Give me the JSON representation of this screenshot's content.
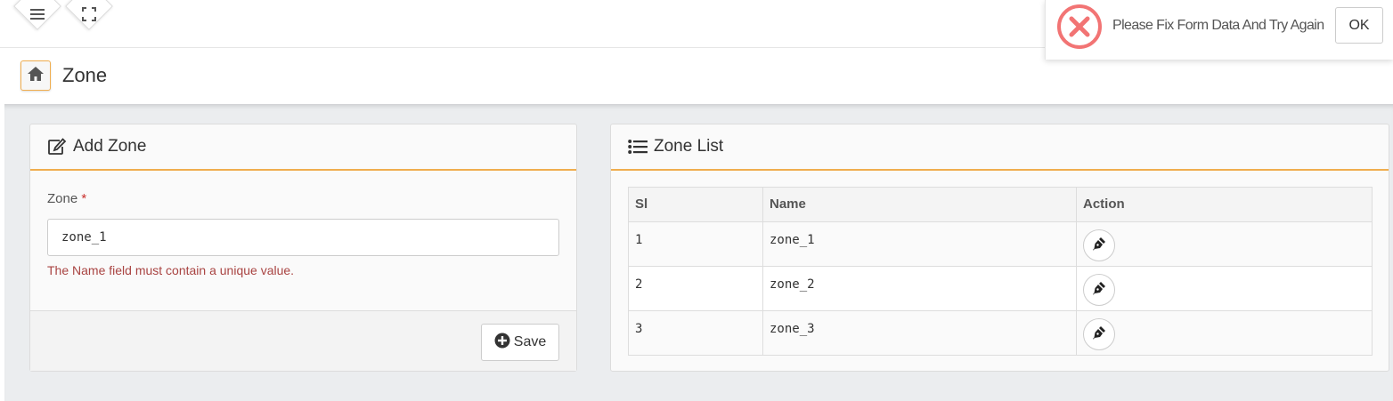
{
  "topbar": {
    "menu_icon": "hamburger-icon",
    "fullscreen_icon": "expand-icon"
  },
  "header": {
    "home_icon": "home-icon",
    "title": "Zone"
  },
  "add_panel": {
    "title": "Add Zone",
    "icon": "edit-icon",
    "field_label": "Zone",
    "required_mark": "*",
    "field_value": "zone_1",
    "error": "The Name field must contain a unique value.",
    "save_label": "Save",
    "save_icon": "plus-circle-icon"
  },
  "list_panel": {
    "title": "Zone List",
    "icon": "list-icon",
    "columns": [
      "Sl",
      "Name",
      "Action"
    ],
    "rows": [
      {
        "sl": "1",
        "name": "zone_1",
        "action_icon": "pen-icon"
      },
      {
        "sl": "2",
        "name": "zone_2",
        "action_icon": "pen-icon"
      },
      {
        "sl": "3",
        "name": "zone_3",
        "action_icon": "pen-icon"
      }
    ]
  },
  "toast": {
    "icon": "error-x-circle-icon",
    "message": "Please Fix Form Data And Try Again",
    "ok_label": "OK"
  },
  "colors": {
    "accent": "#f0ad4e",
    "error": "#a94442",
    "toast_error": "#f27474"
  }
}
